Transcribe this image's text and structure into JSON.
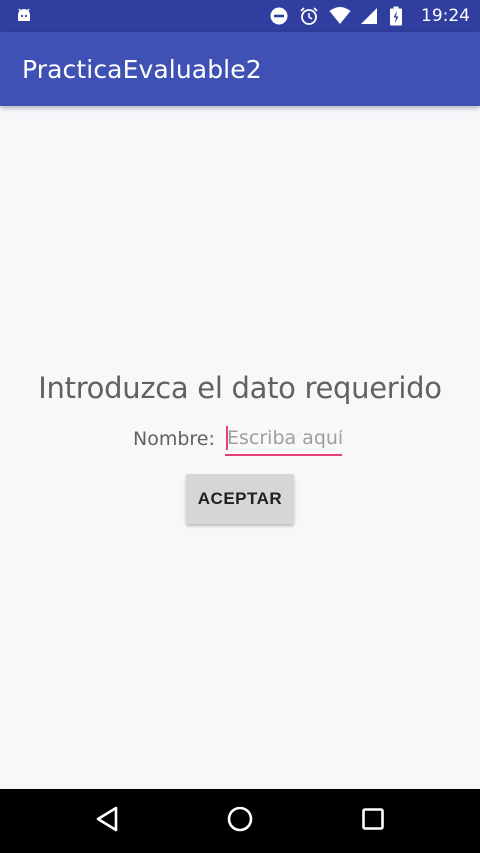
{
  "status_bar": {
    "time": "19:24",
    "icons": [
      "android-debug-icon",
      "do-not-disturb-icon",
      "alarm-icon",
      "wifi-icon",
      "signal-icon",
      "battery-icon"
    ]
  },
  "app_bar": {
    "title": "PracticaEvaluable2"
  },
  "main": {
    "heading": "Introduzca el dato requerido",
    "name_label": "Nombre:",
    "name_input": {
      "value": "",
      "placeholder": "Escriba aquí"
    },
    "accept_label": "ACEPTAR"
  },
  "nav_bar": {
    "buttons": [
      "back-icon",
      "home-icon",
      "recents-icon"
    ]
  },
  "colors": {
    "status_bar": "#303F9F",
    "app_bar": "#3F51B5",
    "accent": "#E5407A",
    "background": "#F8F7FA"
  }
}
